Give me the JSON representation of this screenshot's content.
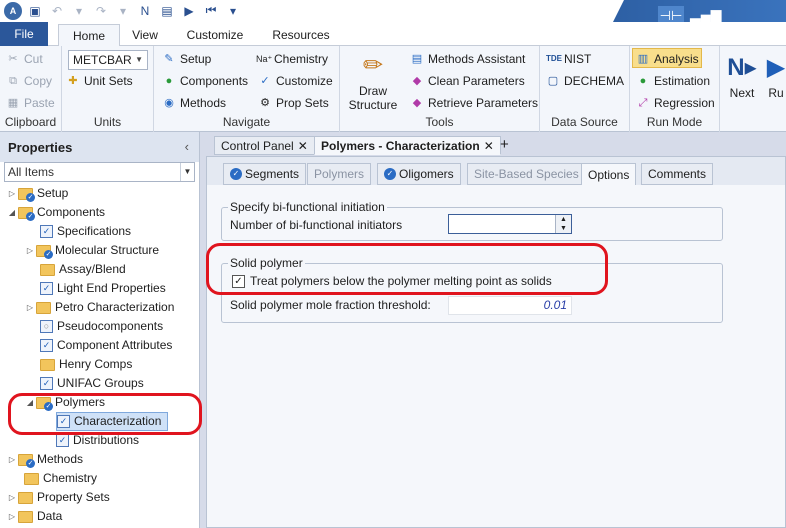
{
  "qat": {
    "icons": [
      "save-icon",
      "undo-icon",
      "redo-icon",
      "next-icon",
      "stream-table-icon",
      "run-icon",
      "reset-icon"
    ]
  },
  "ribbon_tabs": [
    "File",
    "Home",
    "View",
    "Customize",
    "Resources"
  ],
  "ribbon": {
    "clipboard": {
      "label": "Clipboard",
      "cut": "Cut",
      "copy": "Copy",
      "paste": "Paste"
    },
    "units": {
      "label": "Units",
      "unit_set": "METCBAR",
      "unit_sets": "Unit Sets"
    },
    "navigate": {
      "label": "Navigate",
      "setup": "Setup",
      "components": "Components",
      "methods": "Methods",
      "chemistry": "Chemistry",
      "customize": "Customize",
      "prop_sets": "Prop Sets"
    },
    "tools": {
      "label": "Tools",
      "draw_structure_1": "Draw",
      "draw_structure_2": "Structure",
      "methods_assistant": "Methods Assistant",
      "clean_parameters": "Clean Parameters",
      "retrieve_parameters": "Retrieve Parameters"
    },
    "data_source": {
      "label": "Data Source",
      "nist": "NIST",
      "dechema": "DECHEMA"
    },
    "run_mode": {
      "label": "Run Mode",
      "analysis": "Analysis",
      "estimation": "Estimation",
      "regression": "Regression"
    },
    "run": {
      "next": "Next",
      "run": "Ru"
    }
  },
  "properties_pane": {
    "title": "Properties",
    "filter": "All Items",
    "tree": [
      {
        "label": "Setup"
      },
      {
        "label": "Components"
      },
      {
        "label": "Specifications"
      },
      {
        "label": "Molecular Structure"
      },
      {
        "label": "Assay/Blend"
      },
      {
        "label": "Light End Properties"
      },
      {
        "label": "Petro Characterization"
      },
      {
        "label": "Pseudocomponents"
      },
      {
        "label": "Component Attributes"
      },
      {
        "label": "Henry Comps"
      },
      {
        "label": "UNIFAC Groups"
      },
      {
        "label": "Polymers"
      },
      {
        "label": "Characterization"
      },
      {
        "label": "Distributions"
      },
      {
        "label": "Methods"
      },
      {
        "label": "Chemistry"
      },
      {
        "label": "Property Sets"
      },
      {
        "label": "Data"
      }
    ]
  },
  "doc_tabs": {
    "control_panel": "Control Panel",
    "active": "Polymers - Characterization",
    "close": "✕",
    "add": "+"
  },
  "inner_tabs": {
    "segments": "Segments",
    "polymers": "Polymers",
    "oligomers": "Oligomers",
    "site_based": "Site-Based Species",
    "options": "Options",
    "comments": "Comments"
  },
  "form": {
    "bifunctional_legend": "Specify bi-functional initiation",
    "bifunctional_label": "Number of bi-functional initiators",
    "bifunctional_value": "",
    "solid_legend": "Solid polymer",
    "treat_label": "Treat polymers below the polymer melting point as solids",
    "treat_checked": "✓",
    "threshold_label": "Solid polymer mole fraction threshold:",
    "threshold_value": "0.01"
  }
}
